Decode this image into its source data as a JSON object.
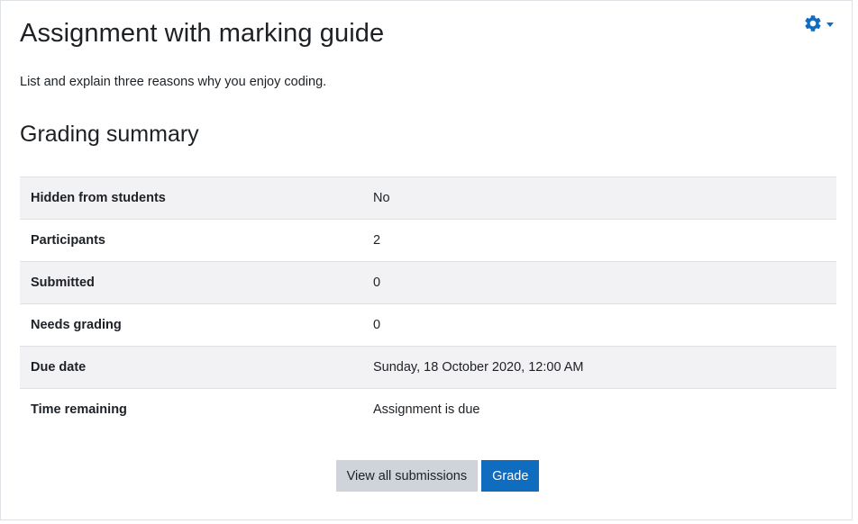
{
  "page": {
    "title": "Assignment with marking guide",
    "intro": "List and explain three reasons why you enjoy coding."
  },
  "icons": {
    "settings": "gear-icon",
    "menu_caret": "caret-down-icon"
  },
  "colors": {
    "accent": "#0f6cbf",
    "secondary_button": "#ced4da",
    "row_stripe": "#f2f1f4"
  },
  "grading_summary": {
    "title": "Grading summary",
    "rows": [
      {
        "label": "Hidden from students",
        "value": "No"
      },
      {
        "label": "Participants",
        "value": "2"
      },
      {
        "label": "Submitted",
        "value": "0"
      },
      {
        "label": "Needs grading",
        "value": "0"
      },
      {
        "label": "Due date",
        "value": "Sunday, 18 October 2020, 12:00 AM"
      },
      {
        "label": "Time remaining",
        "value": "Assignment is due"
      }
    ]
  },
  "actions": {
    "view_all": "View all submissions",
    "grade": "Grade"
  }
}
